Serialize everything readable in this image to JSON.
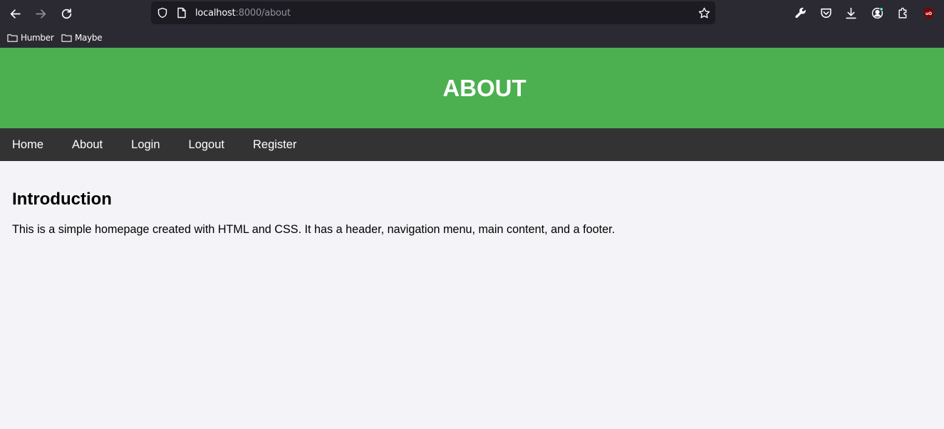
{
  "browser": {
    "url_host": "localhost",
    "url_rest": ":8000/about",
    "bookmarks": [
      {
        "label": "Humber",
        "icon": "folder-icon"
      },
      {
        "label": "Maybe",
        "icon": "folder-icon"
      }
    ],
    "icons": {
      "back": "back-arrow-icon",
      "forward": "forward-arrow-icon",
      "reload": "reload-icon",
      "shield": "shield-icon",
      "page": "page-icon",
      "star": "star-icon",
      "wrench": "wrench-icon",
      "pocket": "pocket-icon",
      "download": "download-icon",
      "account": "account-icon",
      "extensions": "extensions-icon",
      "ublock": "ublock-icon"
    },
    "colors": {
      "chrome": "#2b2a33",
      "urlbar": "#1c1b22",
      "ublock": "#800000"
    }
  },
  "site": {
    "header_title": "ABOUT",
    "nav": [
      {
        "label": "Home"
      },
      {
        "label": "About"
      },
      {
        "label": "Login"
      },
      {
        "label": "Logout"
      },
      {
        "label": "Register"
      }
    ],
    "main": {
      "heading": "Introduction",
      "paragraph": "This is a simple homepage created with HTML and CSS. It has a header, navigation menu, main content, and a footer."
    },
    "colors": {
      "header_bg": "#4caf50",
      "nav_bg": "#333333",
      "body_bg": "#f4f4f8"
    }
  }
}
